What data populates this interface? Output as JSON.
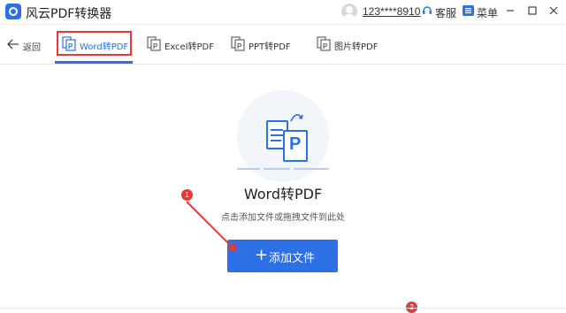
{
  "window": {
    "title": "风云PDF转换器",
    "user": "123****8910",
    "service_label": "客服",
    "menu_label": "菜单",
    "icons": [
      "app-logo",
      "avatar",
      "headset-icon",
      "menu-icon",
      "minimize-icon",
      "maximize-icon",
      "close-icon"
    ]
  },
  "nav": {
    "back_label": "返回",
    "tabs": [
      {
        "label": "Word转PDF",
        "icon": "word-doc-icon",
        "active": true
      },
      {
        "label": "Excel转PDF",
        "icon": "excel-doc-icon",
        "active": false
      },
      {
        "label": "PPT转PDF",
        "icon": "ppt-doc-icon",
        "active": false
      },
      {
        "label": "图片转PDF",
        "icon": "image-doc-icon",
        "active": false
      }
    ]
  },
  "main": {
    "title": "Word转PDF",
    "hint": "点击添加文件或拖拽文件到此处",
    "add_button": "添加文件",
    "hero_letter": "P"
  },
  "annotations": {
    "badge_1": "1",
    "badge_2": "2"
  },
  "colors": {
    "accent": "#2d6fe5",
    "annotation": "#e23b3b"
  }
}
